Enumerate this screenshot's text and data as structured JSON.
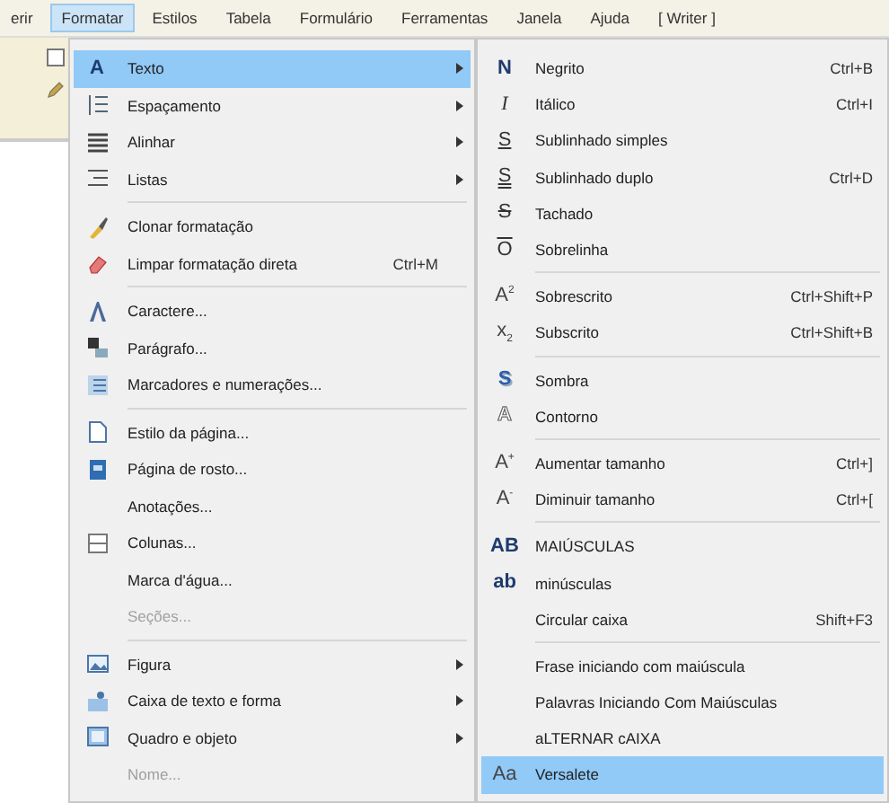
{
  "menubar": [
    {
      "label": "erir",
      "selected": false
    },
    {
      "label": "Formatar",
      "selected": true
    },
    {
      "label": "Estilos",
      "selected": false
    },
    {
      "label": "Tabela",
      "selected": false
    },
    {
      "label": "Formulário",
      "selected": false
    },
    {
      "label": "Ferramentas",
      "selected": false
    },
    {
      "label": "Janela",
      "selected": false
    },
    {
      "label": "Ajuda",
      "selected": false
    },
    {
      "label": "[ Writer ]",
      "selected": false
    }
  ],
  "format_menu": [
    {
      "kind": "item",
      "glyph": "A",
      "label": "Texto",
      "submenu": true,
      "selected": true,
      "disabled": false
    },
    {
      "kind": "item",
      "label": "Espaçamento",
      "submenu": true,
      "selected": false,
      "disabled": false
    },
    {
      "kind": "item",
      "label": "Alinhar",
      "submenu": true,
      "selected": false,
      "disabled": false
    },
    {
      "kind": "item",
      "label": "Listas",
      "submenu": true,
      "selected": false,
      "disabled": false
    },
    {
      "kind": "separator"
    },
    {
      "kind": "item",
      "label": "Clonar formatação",
      "submenu": false,
      "selected": false,
      "disabled": false
    },
    {
      "kind": "item",
      "label": "Limpar formatação direta",
      "shortcut": "Ctrl+M",
      "submenu": false,
      "selected": false,
      "disabled": false
    },
    {
      "kind": "separator"
    },
    {
      "kind": "item",
      "label": "Caractere...",
      "submenu": false,
      "selected": false,
      "disabled": false
    },
    {
      "kind": "item",
      "label": "Parágrafo...",
      "submenu": false,
      "selected": false,
      "disabled": false
    },
    {
      "kind": "item",
      "label": "Marcadores e numerações...",
      "submenu": false,
      "selected": false,
      "disabled": false
    },
    {
      "kind": "separator"
    },
    {
      "kind": "item",
      "label": "Estilo da página...",
      "submenu": false,
      "selected": false,
      "disabled": false
    },
    {
      "kind": "item",
      "label": "Página de rosto...",
      "submenu": false,
      "selected": false,
      "disabled": false
    },
    {
      "kind": "item",
      "label": "Anotações...",
      "submenu": false,
      "selected": false,
      "disabled": false
    },
    {
      "kind": "item",
      "label": "Colunas...",
      "submenu": false,
      "selected": false,
      "disabled": false
    },
    {
      "kind": "item",
      "label": "Marca d'água...",
      "submenu": false,
      "selected": false,
      "disabled": false
    },
    {
      "kind": "item",
      "label": "Seções...",
      "submenu": false,
      "selected": false,
      "disabled": true
    },
    {
      "kind": "separator"
    },
    {
      "kind": "item",
      "label": "Figura",
      "submenu": true,
      "selected": false,
      "disabled": false
    },
    {
      "kind": "item",
      "label": "Caixa de texto e forma",
      "submenu": true,
      "selected": false,
      "disabled": false
    },
    {
      "kind": "item",
      "label": "Quadro e objeto",
      "submenu": true,
      "selected": false,
      "disabled": false
    },
    {
      "kind": "item",
      "label": "Nome...",
      "submenu": false,
      "selected": false,
      "disabled": true
    }
  ],
  "text_submenu": [
    {
      "kind": "item",
      "glyph": "N",
      "label": "Negrito",
      "shortcut": "Ctrl+B",
      "selected": false
    },
    {
      "kind": "item",
      "glyph": "I",
      "label": "Itálico",
      "shortcut": "Ctrl+I",
      "selected": false
    },
    {
      "kind": "item",
      "glyph": "S",
      "label": "Sublinhado simples",
      "selected": false
    },
    {
      "kind": "item",
      "glyph": "S",
      "label": "Sublinhado duplo",
      "shortcut": "Ctrl+D",
      "selected": false
    },
    {
      "kind": "item",
      "glyph": "S",
      "label": "Tachado",
      "selected": false
    },
    {
      "kind": "item",
      "glyph": "O",
      "label": "Sobrelinha",
      "selected": false
    },
    {
      "kind": "separator"
    },
    {
      "kind": "item",
      "glyph": "A$^{2}$",
      "label": "Sobrescrito",
      "shortcut": "Ctrl+Shift+P",
      "selected": false
    },
    {
      "kind": "item",
      "glyph": "x$_{2}$",
      "label": "Subscrito",
      "shortcut": "Ctrl+Shift+B",
      "selected": false
    },
    {
      "kind": "separator"
    },
    {
      "kind": "item",
      "glyph": "S",
      "label": "Sombra",
      "selected": false
    },
    {
      "kind": "item",
      "glyph": "A",
      "label": "Contorno",
      "selected": false
    },
    {
      "kind": "separator"
    },
    {
      "kind": "item",
      "glyph": "A$^{+}$",
      "label": "Aumentar tamanho",
      "shortcut": "Ctrl+]",
      "selected": false
    },
    {
      "kind": "item",
      "glyph": "A$^{-}$",
      "label": "Diminuir tamanho",
      "shortcut": "Ctrl+[",
      "selected": false
    },
    {
      "kind": "separator"
    },
    {
      "kind": "item",
      "glyph": "AB",
      "label": "MAIÚSCULAS",
      "selected": false
    },
    {
      "kind": "item",
      "glyph": "ab",
      "label": "minúsculas",
      "selected": false
    },
    {
      "kind": "item",
      "label": "Circular caixa",
      "shortcut": "Shift+F3",
      "selected": false
    },
    {
      "kind": "separator"
    },
    {
      "kind": "item",
      "label": "Frase iniciando com maiúscula",
      "selected": false
    },
    {
      "kind": "item",
      "label": "Palavras Iniciando Com Maiúsculas",
      "selected": false
    },
    {
      "kind": "item",
      "label": "aLTERNAR cAIXA",
      "selected": false
    },
    {
      "kind": "item",
      "glyph": "Aa",
      "label": "Versalete",
      "selected": true
    }
  ]
}
